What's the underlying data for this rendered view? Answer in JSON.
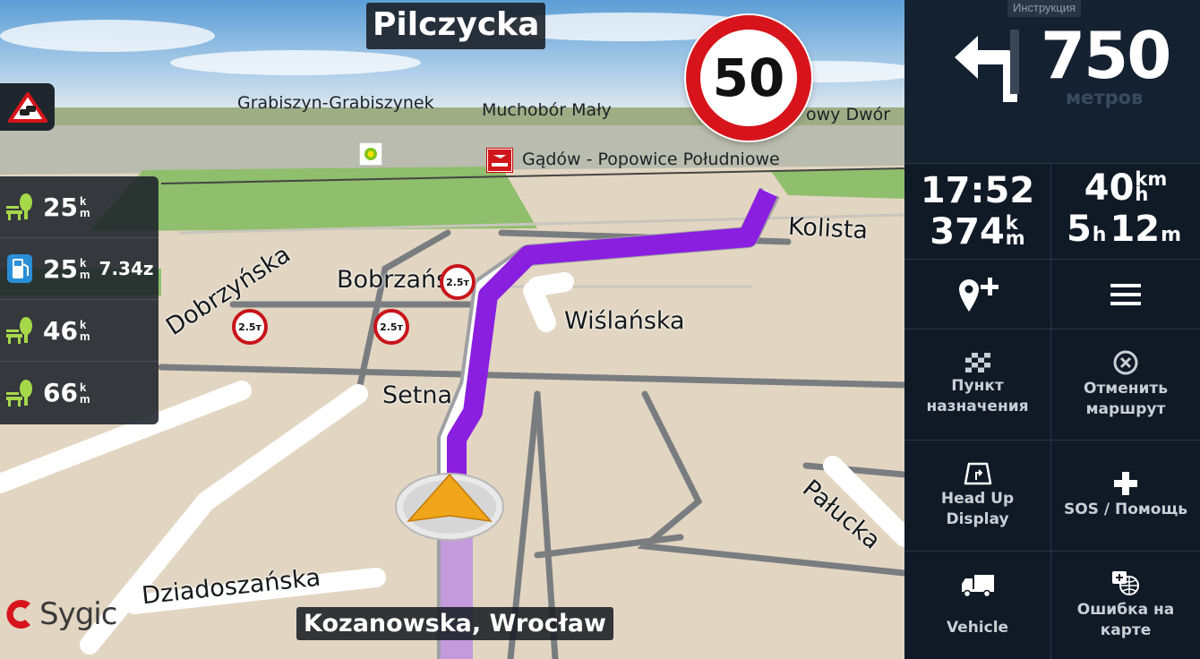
{
  "map": {
    "current_street": "Pilczycka",
    "destination_street": "Kozanowska, Wrocław",
    "speed_limit": "50",
    "place_labels": [
      "Grabiszyn-Grabiszynek",
      "Muchobór Mały",
      "owy Dwór",
      "Gądów - Popowice Południowe"
    ],
    "street_labels": {
      "kolista": "Kolista",
      "bobrzanska": "Bobrzańska",
      "wislanska": "Wiślańska",
      "dobrzynska": "Dobrzyńska",
      "setna": "Setna",
      "palucka": "Pałucka",
      "dziadoszanska": "Dziadoszańska"
    },
    "weight_limit": "2.5т",
    "logo": "Sygic",
    "route_color": "#8a1fe0"
  },
  "poi_panel": [
    {
      "icon": "rest-area-icon",
      "value": "25",
      "unit_top": "k",
      "unit_bottom": "m",
      "extra": ""
    },
    {
      "icon": "fuel-station-icon",
      "value": "25",
      "unit_top": "k",
      "unit_bottom": "m",
      "extra": "7.34z"
    },
    {
      "icon": "rest-area-icon",
      "value": "46",
      "unit_top": "k",
      "unit_bottom": "m",
      "extra": ""
    },
    {
      "icon": "rest-area-icon",
      "value": "66",
      "unit_top": "k",
      "unit_bottom": "m",
      "extra": ""
    }
  ],
  "instruction": {
    "label": "Инструкция",
    "distance": "750",
    "unit": "метров",
    "turn": "left"
  },
  "stats": {
    "time": "17:52",
    "remaining_value": "374",
    "remaining_unit_top": "k",
    "remaining_unit_bottom": "m",
    "speed_value": "40",
    "speed_unit_top": "km",
    "speed_unit_bottom": "h",
    "duration_h": "5",
    "duration_h_unit": "h",
    "duration_m": "12",
    "duration_m_unit": "m"
  },
  "menu": {
    "destination": "Пункт\nназначения",
    "destination_l1": "Пункт",
    "destination_l2": "назначения",
    "cancel_l1": "Отменить",
    "cancel_l2": "маршрут",
    "hud_l1": "Head Up",
    "hud_l2": "Display",
    "sos": "SOS / Помощь",
    "vehicle": "Vehicle",
    "error_l1": "Ошибка на",
    "error_l2": "карте"
  }
}
